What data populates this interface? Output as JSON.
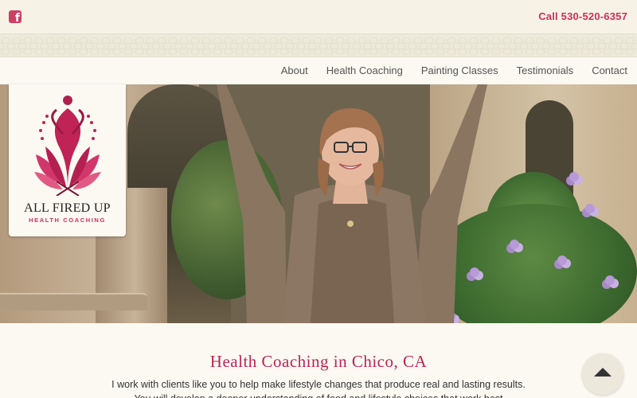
{
  "header": {
    "social_icon": "facebook-icon",
    "phone": "Call 530-520-6357"
  },
  "nav": {
    "items": [
      {
        "label": "About"
      },
      {
        "label": "Health Coaching"
      },
      {
        "label": "Painting Classes"
      },
      {
        "label": "Testimonials"
      },
      {
        "label": "Contact"
      }
    ]
  },
  "logo": {
    "name": "ALL FIRED UP",
    "tagline": "HEALTH COACHING"
  },
  "main": {
    "title": "Health Coaching in Chico, CA",
    "body": "I work with clients like you to help make lifestyle changes that produce real and lasting results. You will develop a deeper understanding of food and lifestyle choices that work best"
  },
  "scroll_top_icon": "caret-up-icon",
  "colors": {
    "accent": "#cf2f5a",
    "background": "#faf8ef"
  }
}
